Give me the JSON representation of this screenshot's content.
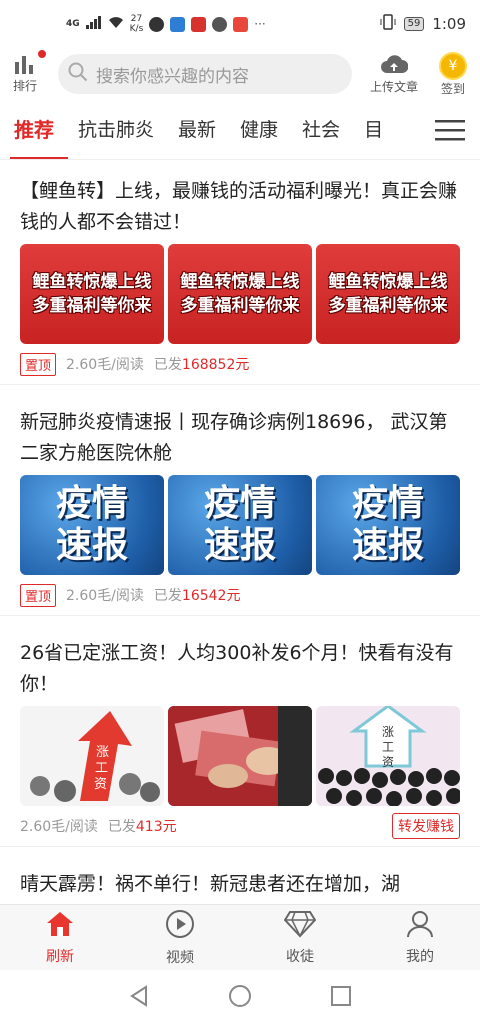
{
  "status_bar": {
    "network": "4G",
    "speed_value": "27",
    "speed_unit": "K/s",
    "battery": "59",
    "time": "1:09"
  },
  "header": {
    "rank_label": "排行",
    "search_placeholder": "搜索你感兴趣的内容",
    "upload_label": "上传文章",
    "checkin_label": "签到",
    "coin_symbol": "¥"
  },
  "tabs": [
    "推荐",
    "抗击肺炎",
    "最新",
    "健康",
    "社会",
    "目"
  ],
  "articles": [
    {
      "title": "【鲤鱼转】上线，最赚钱的活动福利曝光！真正会赚钱的人都不会错过！",
      "thumb_lines": [
        "鲤鱼转惊爆上线",
        "多重福利等你来"
      ],
      "tag": "置顶",
      "rate": "2.60毛/阅读",
      "sent_label": "已发",
      "sent_amount": "168852元"
    },
    {
      "title": "新冠肺炎疫情速报丨现存确诊病例18696， 武汉第二家方舱医院休舱",
      "thumb_lines": [
        "疫情",
        "速报"
      ],
      "tag": "置顶",
      "rate": "2.60毛/阅读",
      "sent_label": "已发",
      "sent_amount": "16542元"
    },
    {
      "title": "26省已定涨工资！人均300补发6个月！快看有没有你！",
      "thumb_text": "涨工资",
      "rate": "2.60毛/阅读",
      "sent_label": "已发",
      "sent_amount": "413元",
      "share_label": "转发赚钱"
    },
    {
      "title": "晴天霹雳！祸不单行！新冠患者还在增加，湖"
    }
  ],
  "bottom_nav": [
    "刷新",
    "视频",
    "收徒",
    "我的"
  ],
  "colors": {
    "accent": "#e02a2a"
  }
}
